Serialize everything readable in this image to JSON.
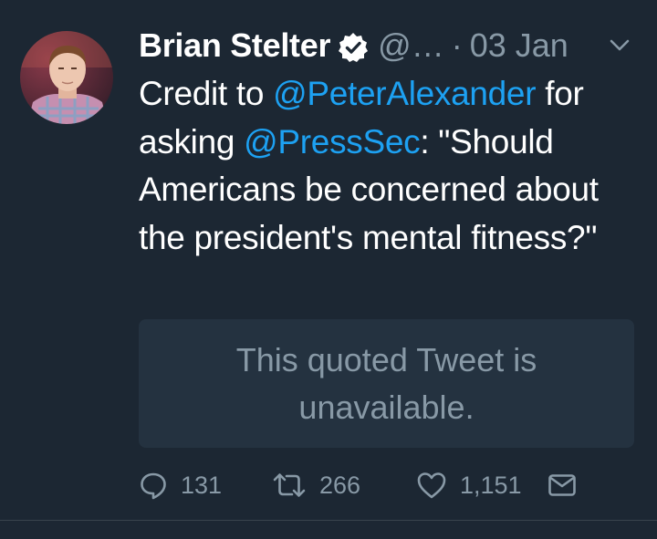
{
  "tweet": {
    "author_name": "Brian Stelter",
    "handle": "@…",
    "separator": "·",
    "date": "03 Jan",
    "text_parts": {
      "p1": "Credit to ",
      "mention1": "@PeterAlexander",
      "p2": " for asking ",
      "mention2": "@PressSec",
      "p3": ": \"Should Americans be concerned about the president's mental fitness?\""
    },
    "quoted": {
      "message": "This quoted Tweet is unavailable."
    },
    "actions": {
      "replies": "131",
      "retweets": "266",
      "likes": "1,151"
    },
    "colors": {
      "background": "#1c2733",
      "link": "#1da1f2",
      "muted": "#8899a6",
      "quote_bg": "#243240"
    },
    "icons": [
      "verified-badge-icon",
      "chevron-down-icon",
      "reply-icon",
      "retweet-icon",
      "like-icon",
      "direct-message-icon"
    ]
  }
}
